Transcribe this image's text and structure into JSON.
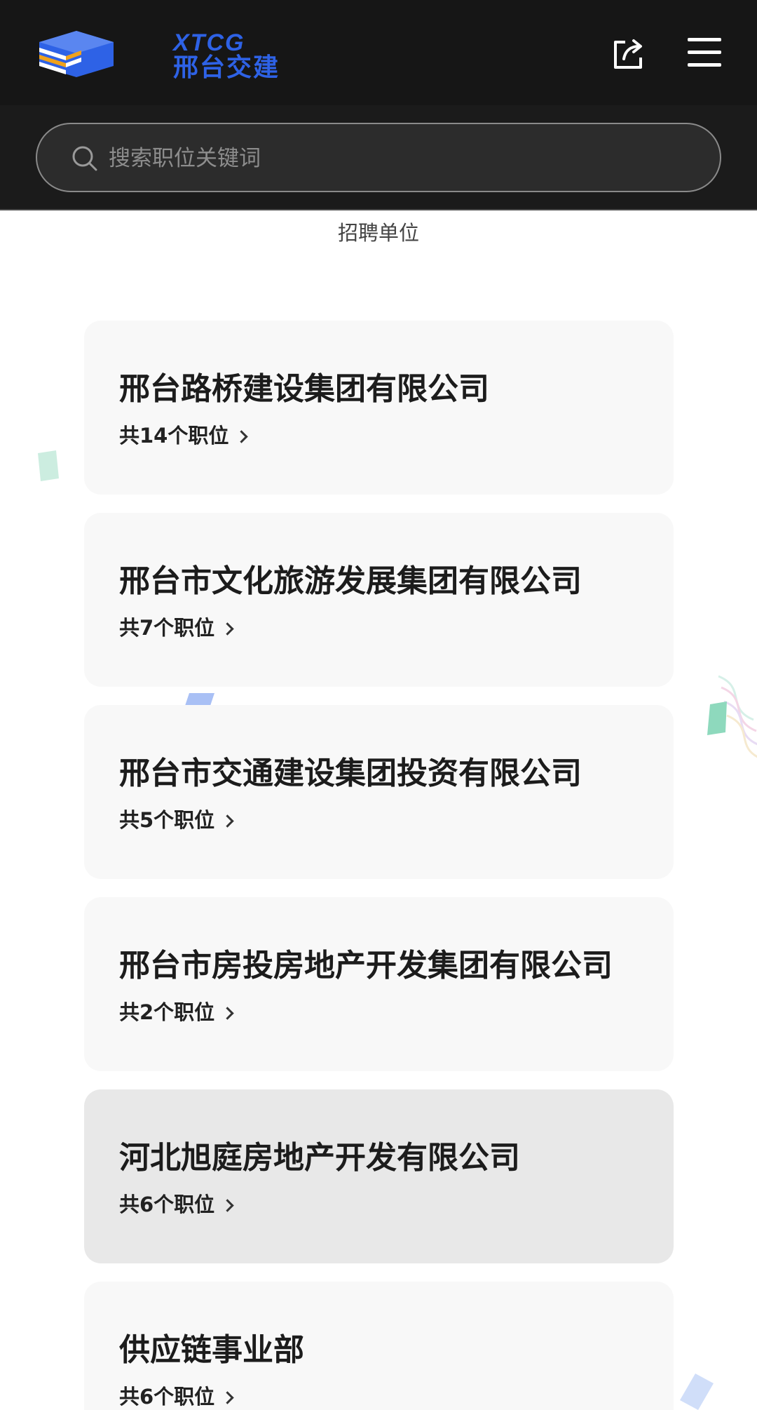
{
  "header": {
    "logo": {
      "name_en": "XTCG",
      "name_cn": "邢台交建",
      "colors": {
        "blue": "#2e62e6",
        "orange": "#f0a21c",
        "white": "#ffffff"
      }
    },
    "share_icon": "share-icon",
    "menu_icon": "hamburger-menu-icon"
  },
  "search": {
    "placeholder": "搜索职位关键词",
    "value": ""
  },
  "section_title": "招聘单位",
  "companies": [
    {
      "name": "邢台路桥建设集团有限公司",
      "positions": "共14个职位"
    },
    {
      "name": "邢台市文化旅游发展集团有限公司",
      "positions": "共7个职位"
    },
    {
      "name": "邢台市交通建设集团投资有限公司",
      "positions": "共5个职位"
    },
    {
      "name": "邢台市房投房地产开发集团有限公司",
      "positions": "共2个职位"
    },
    {
      "name": "河北旭庭房地产开发有限公司",
      "positions": "共6个职位"
    },
    {
      "name": "供应链事业部",
      "positions": "共6个职位"
    }
  ],
  "colors": {
    "header_bg": "#161616",
    "card_bg": "#f8f8f8",
    "card_active_bg": "#e8e8e8",
    "text_primary": "#1c1c1c"
  }
}
